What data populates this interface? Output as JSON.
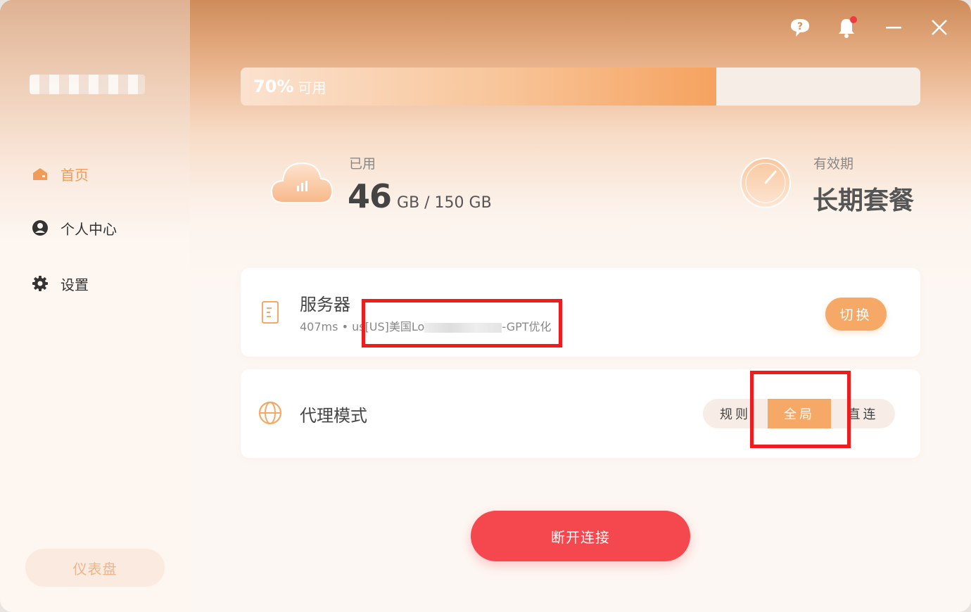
{
  "sidebar": {
    "items": [
      {
        "label": "首页",
        "icon": "home-icon",
        "active": true
      },
      {
        "label": "个人中心",
        "icon": "user-circle-icon",
        "active": false
      },
      {
        "label": "设置",
        "icon": "gear-icon",
        "active": false
      }
    ],
    "dashboard_label": "仪表盘"
  },
  "titlebar": {
    "icons": [
      "help-icon",
      "bell-icon",
      "minimize-icon",
      "close-icon"
    ]
  },
  "usage": {
    "available_percent": 70,
    "available_text": "70%",
    "available_suffix": "可用",
    "used_label": "已用",
    "used_value": "46",
    "used_total": "GB / 150 GB",
    "validity_label": "有效期",
    "validity_value": "长期套餐"
  },
  "server": {
    "title": "服务器",
    "latency": "407ms",
    "prefix": "• us",
    "name_start": "[US]美国Lo",
    "name_end": "-GPT优化",
    "switch_label": "切换"
  },
  "proxy": {
    "title": "代理模式",
    "options": [
      "规则",
      "全局",
      "直连"
    ],
    "selected": "全局"
  },
  "action": {
    "disconnect_label": "断开连接"
  },
  "colors": {
    "accent": "#f6a866",
    "active_nav": "#f29a57",
    "disconnect": "#f4484e",
    "annotation": "#ee1c1c"
  }
}
